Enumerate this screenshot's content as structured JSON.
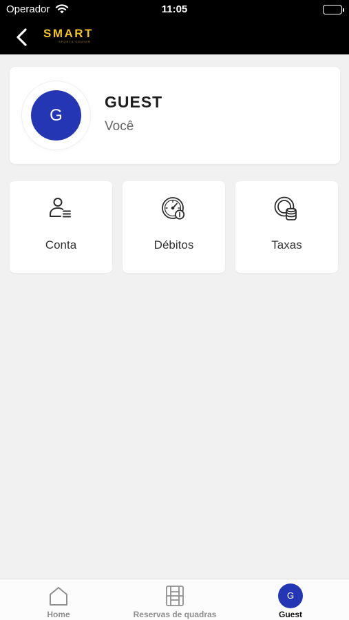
{
  "status_bar": {
    "carrier": "Operador",
    "time": "11:05"
  },
  "header": {
    "brand": "SMART",
    "brand_subtitle": "SPORTS CENTER"
  },
  "profile": {
    "initial": "G",
    "name": "GUEST",
    "subtitle": "Você"
  },
  "tiles": [
    {
      "label": "Conta",
      "icon": "user-list-icon"
    },
    {
      "label": "Débitos",
      "icon": "gauge-dollar-icon"
    },
    {
      "label": "Taxas",
      "icon": "coins-icon"
    }
  ],
  "tab_bar": {
    "items": [
      {
        "label": "Home",
        "icon": "home-icon"
      },
      {
        "label": "Reservas de quadras",
        "icon": "court-icon"
      },
      {
        "label": "Guest",
        "initial": "G"
      }
    ],
    "active_index": 2
  },
  "colors": {
    "brand_yellow": "#f3c41b",
    "avatar_blue": "#2536b4",
    "header_black": "#000000",
    "page_background": "#f1f1f1"
  }
}
